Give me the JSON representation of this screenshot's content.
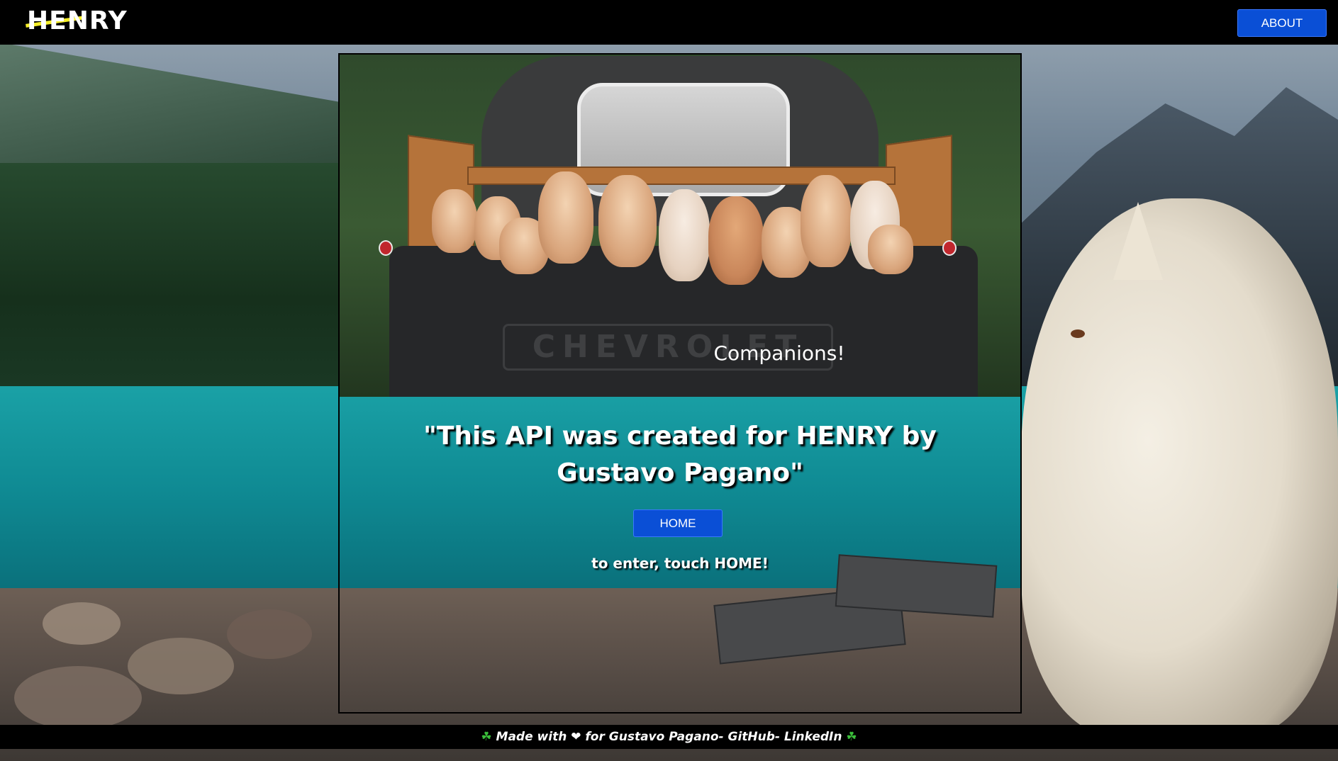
{
  "navbar": {
    "logo_text": "HENRY",
    "about_label": "ABOUT"
  },
  "card": {
    "caption": "Companions!",
    "tailgate_brand": "CHEVROLET",
    "headline": "\"This API was created for HENRY by Gustavo Pagano\"",
    "home_label": "HOME",
    "enter_text": "to enter, touch HOME!"
  },
  "footer": {
    "left_icon": "clover-icon",
    "made_with": "Made with",
    "heart_icon": "heart-icon",
    "for_text": "for Gustavo Pagano-",
    "github_label": "GitHub-",
    "linkedin_label": "LinkedIn",
    "right_icon": "clover-icon"
  },
  "colors": {
    "navbar_bg": "#000000",
    "button_blue": "#0a4fd6",
    "logo_accent": "#f5ee2a",
    "footer_bg": "#000000"
  }
}
